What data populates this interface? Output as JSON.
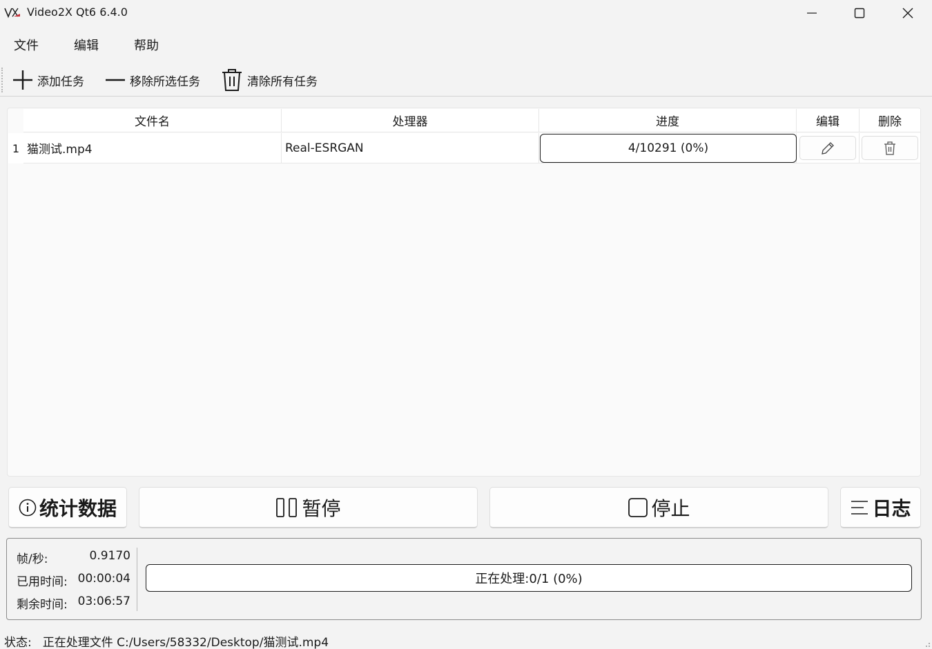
{
  "window": {
    "title": "Video2X Qt6 6.4.0",
    "controls": [
      "minimize-icon",
      "maximize-icon",
      "close-icon"
    ]
  },
  "menu": {
    "items": [
      "文件",
      "编辑",
      "帮助"
    ]
  },
  "toolbar": {
    "add_task": "添加任务",
    "remove_selected": "移除所选任务",
    "clear_all": "清除所有任务"
  },
  "table": {
    "columns": [
      "文件名",
      "处理器",
      "进度",
      "编辑",
      "删除"
    ],
    "rows": [
      {
        "index": "1",
        "filename": "猫测试.mp4",
        "processor": "Real-ESRGAN",
        "progress": "4/10291 (0%)",
        "progress_fraction": 0.0004,
        "edit_icon": "pencil-icon",
        "delete_icon": "trash-icon"
      }
    ]
  },
  "controls": {
    "stats": "统计数据",
    "pause": "暂停",
    "stop": "停止",
    "log": "日志"
  },
  "stats": {
    "fps_label": "帧/秒:",
    "fps_value": "0.9170",
    "elapsed_label": "已用时间:",
    "elapsed_value": "00:00:04",
    "remaining_label": "剩余时间:",
    "remaining_value": "03:06:57",
    "overall_progress": "正在处理:0/1 (0%)",
    "overall_fraction": 0
  },
  "status": {
    "label": "状态:",
    "text": "正在处理文件 C:/Users/58332/Desktop/猫测试.mp4"
  },
  "colors": {
    "background": "#f3f3f3",
    "accent_logo": "#c8323c"
  }
}
